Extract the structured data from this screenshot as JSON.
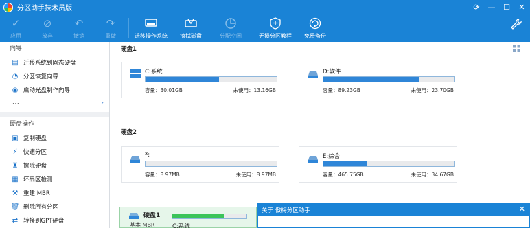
{
  "window": {
    "title": "分区助手技术员版",
    "controls": [
      "refresh",
      "minimize",
      "restore",
      "close"
    ]
  },
  "toolbar": {
    "buttons": [
      {
        "label": "应用",
        "icon": "check-icon",
        "enabled": false
      },
      {
        "label": "放弃",
        "icon": "discard-icon",
        "enabled": false
      },
      {
        "label": "撤销",
        "icon": "undo-icon",
        "enabled": false
      },
      {
        "label": "重做",
        "icon": "redo-icon",
        "enabled": false
      },
      {
        "label": "迁移操作系统",
        "icon": "migrate-os-icon",
        "enabled": true
      },
      {
        "label": "擦拭磁盘",
        "icon": "wipe-disk-icon",
        "enabled": true
      },
      {
        "label": "分配空闲",
        "icon": "allocate-space-icon",
        "enabled": false
      },
      {
        "label": "无损分区教程",
        "icon": "tutorial-icon",
        "enabled": true
      },
      {
        "label": "免费备份",
        "icon": "backup-icon",
        "enabled": true
      }
    ]
  },
  "sidebar": {
    "wizard_title": "向导",
    "wizard_items": [
      {
        "label": "迁移系统到固态硬盘",
        "icon": "migrate-icon"
      },
      {
        "label": "分区恢复向导",
        "icon": "recover-icon"
      },
      {
        "label": "启动光盘制作向导",
        "icon": "boot-disc-icon"
      }
    ],
    "more_label": "...",
    "disk_ops_title": "硬盘操作",
    "disk_ops_items": [
      {
        "label": "复制硬盘",
        "icon": "copy-disk-icon"
      },
      {
        "label": "快速分区",
        "icon": "quick-partition-icon"
      },
      {
        "label": "擦除硬盘",
        "icon": "erase-disk-icon"
      },
      {
        "label": "坏扇区检测",
        "icon": "bad-sector-icon"
      },
      {
        "label": "重建 MBR",
        "icon": "rebuild-mbr-icon"
      },
      {
        "label": "删除所有分区",
        "icon": "delete-all-icon"
      },
      {
        "label": "转换到GPT硬盘",
        "icon": "convert-gpt-icon"
      }
    ]
  },
  "disks": [
    {
      "label": "硬盘1",
      "partitions": [
        {
          "name": "C:系统",
          "capacity_label": "容量：30.01GB",
          "free_label": "未使用：13.16GB",
          "used_fraction": 0.56,
          "icon": "windows-icon"
        },
        {
          "name": "D:软件",
          "capacity_label": "容量：89.23GB",
          "free_label": "未使用：23.70GB",
          "used_fraction": 0.73,
          "icon": "drive-icon"
        }
      ]
    },
    {
      "label": "硬盘2",
      "partitions": [
        {
          "name": "*:",
          "capacity_label": "容量：8.97MB",
          "free_label": "未使用：8.97MB",
          "used_fraction": 0.0,
          "icon": "drive-icon"
        },
        {
          "name": "E:综合",
          "capacity_label": "容量：465.75GB",
          "free_label": "未使用：34.67GB",
          "used_fraction": 0.33,
          "icon": "drive-icon"
        }
      ]
    }
  ],
  "disk_list": {
    "name": "硬盘1",
    "sub": "基本 MBR",
    "partition": "C:系统"
  },
  "dialog": {
    "title": "关于 傲梅分区助手"
  },
  "colors": {
    "accent": "#1a83d6",
    "bar_fill": "#2f86d8",
    "disk_row_fill": "#3bc35a"
  }
}
